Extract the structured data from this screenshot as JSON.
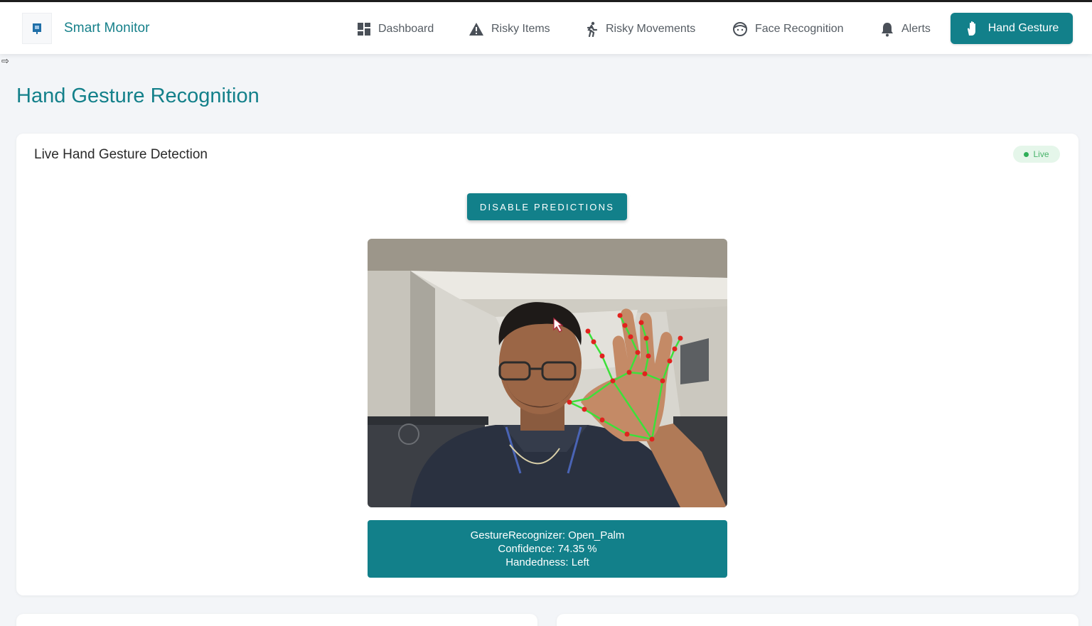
{
  "app": {
    "title": "Smart Monitor"
  },
  "nav": {
    "items": [
      {
        "label": "Dashboard",
        "icon": "dashboard-grid-icon"
      },
      {
        "label": "Risky Items",
        "icon": "warning-triangle-icon"
      },
      {
        "label": "Risky Movements",
        "icon": "running-person-icon"
      },
      {
        "label": "Face Recognition",
        "icon": "face-icon"
      },
      {
        "label": "Alerts",
        "icon": "bell-icon"
      }
    ],
    "active": {
      "label": "Hand Gesture",
      "icon": "hand-icon"
    }
  },
  "page": {
    "title": "Hand Gesture Recognition"
  },
  "card": {
    "title": "Live Hand Gesture Detection",
    "badge": "Live",
    "toggle_button": "Disable Predictions"
  },
  "result": {
    "gesture": "GestureRecognizer: Open_Palm",
    "confidence": "Confidence: 74.35 %",
    "handedness": "Handedness: Left"
  },
  "colors": {
    "primary": "#12808a",
    "live_green": "#2fae58",
    "landmark_point": "#e0231e",
    "landmark_line": "#3de03a"
  }
}
